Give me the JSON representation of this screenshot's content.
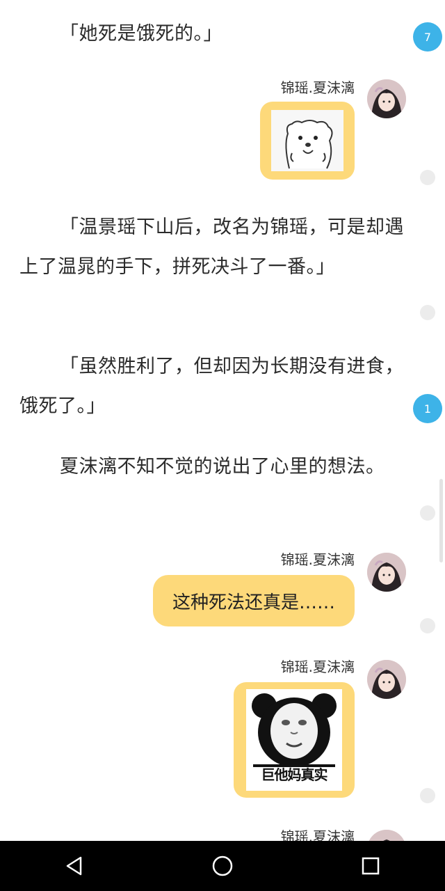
{
  "paragraphs": [
    "「她死是饿死的。」",
    "「温景瑶下山后，改名为锦瑶，可是却遇上了温晁的手下，拼死决斗了一番。」",
    "「虽然胜利了，但却因为长期没有进食，饿死了。」",
    "夏沫漓不知不觉的说出了心里的想法。"
  ],
  "badges": {
    "first": "7",
    "second": "1"
  },
  "messages": {
    "author": "锦瑶.夏沫漓",
    "text_message": "这种死法还真是……",
    "meme_caption": "巨他妈真实"
  },
  "colors": {
    "bubble": "#fdd97a",
    "badge": "#3db3e8",
    "navbar": "#000000"
  }
}
